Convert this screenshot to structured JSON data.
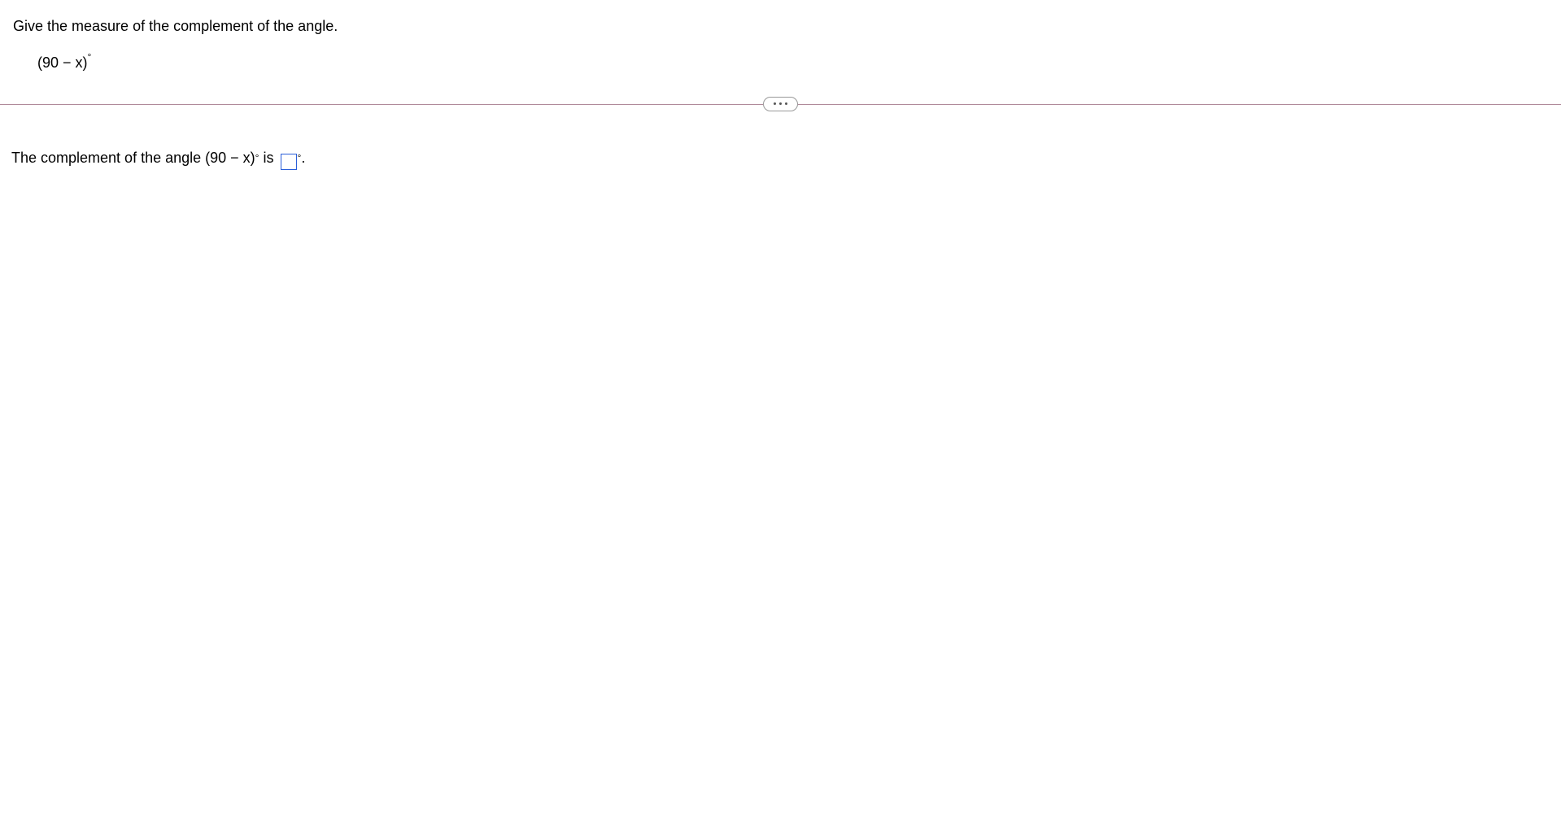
{
  "question": {
    "prompt": "Give the measure of the complement of the angle.",
    "angle_open": "(90 ",
    "angle_minus": "−",
    "angle_close": " x)",
    "degree": "°"
  },
  "answer": {
    "prefix": "The complement of the angle (90 ",
    "minus": "−",
    "mid": " x)",
    "degree1": "°",
    "is": " is ",
    "degree2": "°",
    "period": ".",
    "input_value": ""
  }
}
